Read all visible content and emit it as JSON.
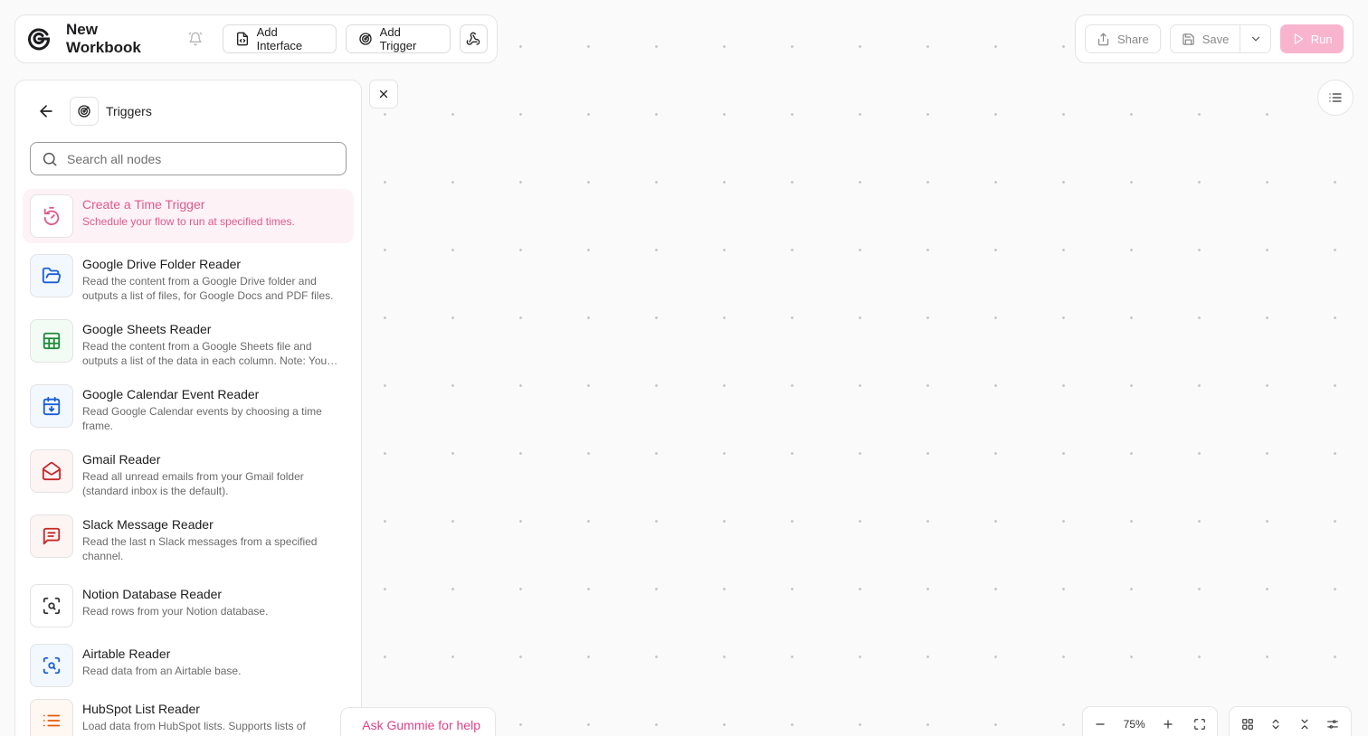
{
  "header": {
    "workbook_title": "New Workbook",
    "add_interface_label": "Add Interface",
    "add_trigger_label": "Add Trigger"
  },
  "actions": {
    "share_label": "Share",
    "save_label": "Save",
    "run_label": "Run"
  },
  "panel": {
    "title": "Triggers",
    "search_placeholder": "Search all nodes",
    "nodes": [
      {
        "title": "Create a Time Trigger",
        "desc": "Schedule your flow to run at specified times.",
        "icon": "timer-icon",
        "color": "#e05a8c"
      },
      {
        "title": "Google Drive Folder Reader",
        "desc": "Read the content from a Google Drive folder and outputs a list of files, for Google Docs and PDF files.",
        "icon": "folder-open-icon",
        "color": "#1a5fd6"
      },
      {
        "title": "Google Sheets Reader",
        "desc": "Read the content from a Google Sheets file and outputs a list of the data in each column. Note: You need to share the sheet.",
        "icon": "sheet-icon",
        "color": "#1d8a3a"
      },
      {
        "title": "Google Calendar Event Reader",
        "desc": "Read Google Calendar events by choosing a time frame.",
        "icon": "calendar-icon",
        "color": "#1a5fd6"
      },
      {
        "title": "Gmail Reader",
        "desc": "Read all unread emails from your Gmail folder (standard inbox is the default).",
        "icon": "mail-open-icon",
        "color": "#c62828"
      },
      {
        "title": "Slack Message Reader",
        "desc": "Read the last n Slack messages from a specified channel.",
        "icon": "message-icon",
        "color": "#c62828"
      },
      {
        "title": "Notion Database Reader",
        "desc": "Read rows from your Notion database.",
        "icon": "scan-search-icon",
        "color": "#333333"
      },
      {
        "title": "Airtable Reader",
        "desc": "Read data from an Airtable base.",
        "icon": "scan-search-icon",
        "color": "#1a5fd6"
      },
      {
        "title": "HubSpot List Reader",
        "desc": "Load data from HubSpot lists. Supports lists of",
        "icon": "list-icon",
        "color": "#e8590c"
      }
    ]
  },
  "help": {
    "label": "Ask Gummie for help"
  },
  "zoom": {
    "level": "75%"
  },
  "colors": {
    "accent": "#e05a8c",
    "run_button": "#f8b4cd",
    "help_text": "#e0428a"
  }
}
